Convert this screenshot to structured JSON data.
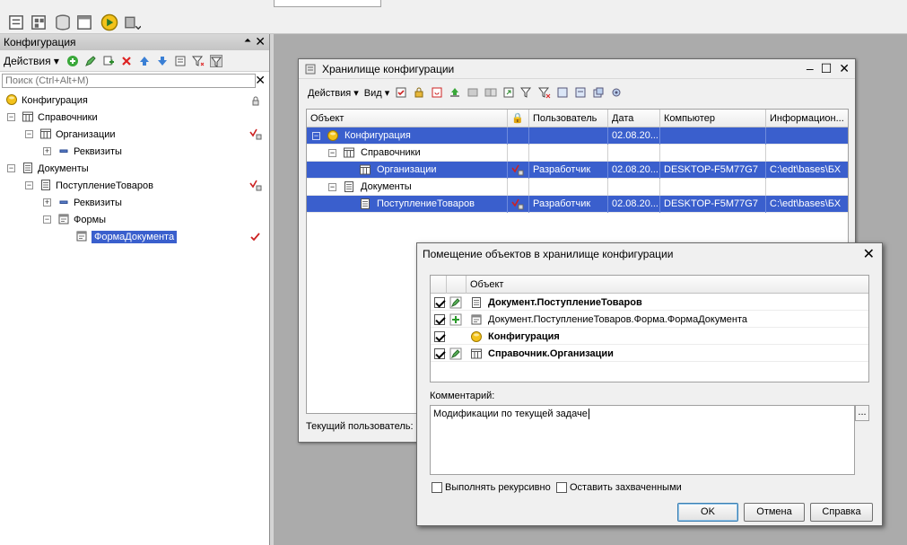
{
  "toolbar": {
    "search_placeholder": ""
  },
  "config_panel": {
    "title": "Конфигурация",
    "actions_label": "Действия",
    "search_placeholder": "Поиск (Ctrl+Alt+M)",
    "tree": [
      {
        "label": "Конфигурация",
        "level": 0,
        "icon": "config-ball-icon",
        "expander": "none"
      },
      {
        "label": "Справочники",
        "level": 0,
        "icon": "catalog-icon",
        "expander": "minus"
      },
      {
        "label": "Организации",
        "level": 1,
        "icon": "catalog-icon",
        "expander": "minus"
      },
      {
        "label": "Реквизиты",
        "level": 2,
        "icon": "attributes-icon",
        "expander": "plus"
      },
      {
        "label": "Документы",
        "level": 0,
        "icon": "document-icon",
        "expander": "minus"
      },
      {
        "label": "ПоступлениеТоваров",
        "level": 1,
        "icon": "document-icon",
        "expander": "minus"
      },
      {
        "label": "Реквизиты",
        "level": 2,
        "icon": "attributes-icon",
        "expander": "plus"
      },
      {
        "label": "Формы",
        "level": 2,
        "icon": "forms-icon",
        "expander": "minus"
      },
      {
        "label": "ФормаДокумента",
        "level": 3,
        "icon": "form-icon",
        "expander": "none",
        "selected": true
      }
    ]
  },
  "storage_window": {
    "title": "Хранилище конфигурации",
    "actions_label": "Действия",
    "view_label": "Вид",
    "columns": [
      "Объект",
      "",
      "Пользователь",
      "Дата",
      "Компьютер",
      "Информацион..."
    ],
    "rows": [
      {
        "object": "Конфигурация",
        "user": "",
        "date": "02.08.20...",
        "computer": "",
        "info": "",
        "selected": true
      },
      {
        "object": "Справочники",
        "user": "",
        "date": "",
        "computer": "",
        "info": "",
        "selected": false
      },
      {
        "object": "Организации",
        "user": "Разработчик",
        "date": "02.08.20...",
        "computer": "DESKTOP-F5M77G7",
        "info": "C:\\edt\\bases\\БХ",
        "selected": true
      },
      {
        "object": "Документы",
        "user": "",
        "date": "",
        "computer": "",
        "info": "",
        "selected": false
      },
      {
        "object": "ПоступлениеТоваров",
        "user": "Разработчик",
        "date": "02.08.20...",
        "computer": "DESKTOP-F5M77G7",
        "info": "C:\\edt\\bases\\БХ",
        "selected": true
      }
    ],
    "current_user_label": "Текущий пользователь:"
  },
  "dialog": {
    "title": "Помещение объектов в хранилище конфигурации",
    "column_object": "Объект",
    "objects": [
      {
        "name": "Документ.ПоступлениеТоваров",
        "bold": true,
        "checked": true,
        "action": "edit"
      },
      {
        "name": "Документ.ПоступлениеТоваров.Форма.ФормаДокумента",
        "bold": false,
        "checked": true,
        "action": "add"
      },
      {
        "name": "Конфигурация",
        "bold": true,
        "checked": true,
        "action": "none"
      },
      {
        "name": "Справочник.Организации",
        "bold": true,
        "checked": true,
        "action": "edit"
      }
    ],
    "comment_label": "Комментарий:",
    "comment_value": "Модификации по текущей задаче",
    "dots_label": "...",
    "recursive_label": "Выполнять рекурсивно",
    "keep_locked_label": "Оставить захваченными",
    "ok_label": "OK",
    "cancel_label": "Отмена",
    "help_label": "Справка"
  },
  "colors": {
    "selection": "#3a5fcd",
    "background": "#ababab"
  }
}
